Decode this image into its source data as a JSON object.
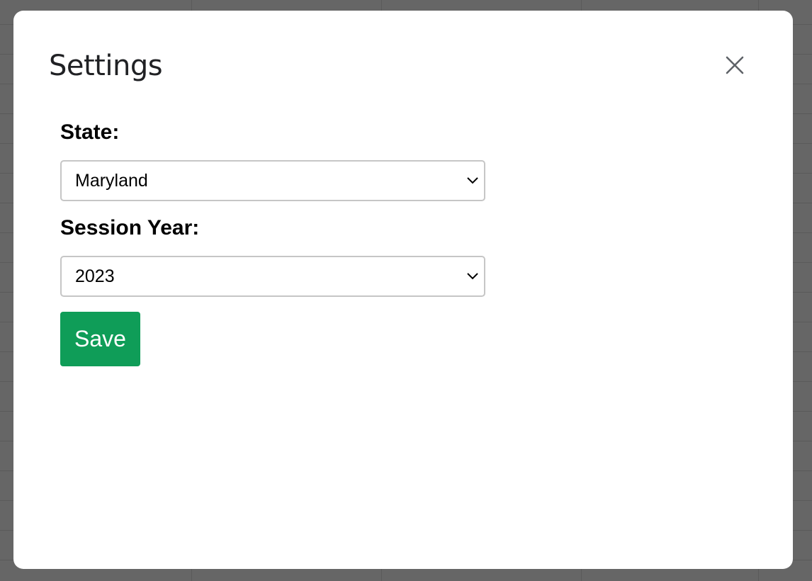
{
  "dialog": {
    "title": "Settings",
    "close_icon": "close-icon"
  },
  "form": {
    "state_label": "State:",
    "state_value": "Maryland",
    "session_year_label": "Session Year:",
    "session_year_value": "2023",
    "dropdown_icon": "chevron-down-icon",
    "save_label": "Save"
  },
  "colors": {
    "backdrop": "#666666",
    "dialog_background": "#ffffff",
    "save_button": "#0f9d58",
    "select_border": "#c6c6c6"
  }
}
